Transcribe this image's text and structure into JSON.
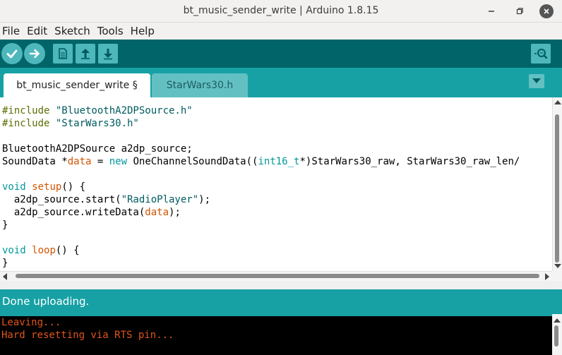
{
  "window": {
    "title": "bt_music_sender_write | Arduino 1.8.15"
  },
  "menu": {
    "items": [
      {
        "label": "File"
      },
      {
        "label": "Edit"
      },
      {
        "label": "Sketch"
      },
      {
        "label": "Tools"
      },
      {
        "label": "Help"
      }
    ]
  },
  "toolbar": {
    "buttons": [
      {
        "name": "verify",
        "icon": "checkmark-icon"
      },
      {
        "name": "upload",
        "icon": "arrow-right-icon"
      },
      {
        "name": "new",
        "icon": "document-icon"
      },
      {
        "name": "open",
        "icon": "arrow-up-icon"
      },
      {
        "name": "save",
        "icon": "arrow-down-icon"
      },
      {
        "name": "serial-monitor",
        "icon": "magnifier-icon"
      }
    ]
  },
  "tabs": [
    {
      "label": "bt_music_sender_write §",
      "active": true
    },
    {
      "label": "StarWars30.h",
      "active": false
    }
  ],
  "code": {
    "lines": [
      [
        {
          "t": "#include ",
          "c": "pp"
        },
        {
          "t": "\"BluetoothA2DPSource.h\"",
          "c": "str"
        }
      ],
      [
        {
          "t": "#include ",
          "c": "pp"
        },
        {
          "t": "\"StarWars30.h\"",
          "c": "str"
        }
      ],
      [],
      [
        {
          "t": "BluetoothA2DPSource a2dp_source;",
          "c": ""
        }
      ],
      [
        {
          "t": "SoundData *",
          "c": ""
        },
        {
          "t": "data",
          "c": "fn"
        },
        {
          "t": " = ",
          "c": ""
        },
        {
          "t": "new",
          "c": "kw"
        },
        {
          "t": " OneChannelSoundData((",
          "c": ""
        },
        {
          "t": "int16_t",
          "c": "ty"
        },
        {
          "t": "*)StarWars30_raw, StarWars30_raw_len/",
          "c": ""
        }
      ],
      [],
      [
        {
          "t": "void",
          "c": "kw"
        },
        {
          "t": " ",
          "c": ""
        },
        {
          "t": "setup",
          "c": "fn"
        },
        {
          "t": "() {",
          "c": ""
        }
      ],
      [
        {
          "t": "  a2dp_source.start(",
          "c": ""
        },
        {
          "t": "\"RadioPlayer\"",
          "c": "str"
        },
        {
          "t": ");",
          "c": ""
        }
      ],
      [
        {
          "t": "  a2dp_source.writeData(",
          "c": ""
        },
        {
          "t": "data",
          "c": "fn"
        },
        {
          "t": ");",
          "c": ""
        }
      ],
      [
        {
          "t": "}",
          "c": ""
        }
      ],
      [],
      [
        {
          "t": "void",
          "c": "kw"
        },
        {
          "t": " ",
          "c": ""
        },
        {
          "t": "loop",
          "c": "fn"
        },
        {
          "t": "() {",
          "c": ""
        }
      ],
      [
        {
          "t": "}",
          "c": ""
        }
      ]
    ]
  },
  "status": {
    "message": "Done uploading."
  },
  "console": {
    "lines": [
      "Leaving...",
      "Hard resetting via RTS pin..."
    ]
  },
  "colors": {
    "toolbar": "#006468",
    "tabstrip": "#17a1a5",
    "console_text": "#e0541c"
  }
}
